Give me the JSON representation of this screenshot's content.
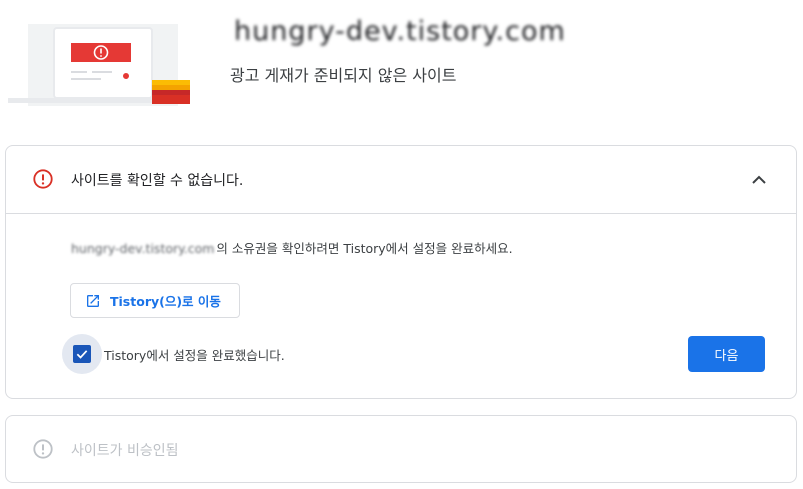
{
  "header": {
    "site_domain": "hungry-dev.tistory.com",
    "subtitle": "광고 게재가 준비되지 않은 사이트"
  },
  "verify_card": {
    "title": "사이트를 확인할 수 없습니다.",
    "status_icon": "error-circle-icon",
    "collapse_icon": "chevron-up-icon",
    "site_name_blurred": "hungry-dev.tistory.com",
    "description_suffix": "의 소유권을 확인하려면 Tistory에서 설정을 완료하세요.",
    "goto_button_label": "Tistory(으)로 이동",
    "goto_icon": "open-in-new-icon",
    "checkbox_label": "Tistory에서 설정을 완료했습니다.",
    "checkbox_checked": true,
    "next_button_label": "다음"
  },
  "approval_card": {
    "title": "사이트가 비승인됨",
    "status_icon": "error-circle-icon"
  },
  "colors": {
    "accent": "#1a73e8",
    "error": "#d93025",
    "disabled_text": "#bdc1c6",
    "border": "#dadce0"
  }
}
